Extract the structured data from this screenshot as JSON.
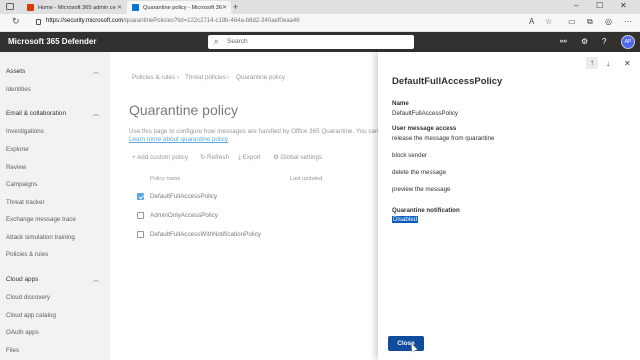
{
  "browser": {
    "tabs": [
      {
        "title": "Home - Microsoft 365 admin ce",
        "favicon_color": "#d83b01"
      },
      {
        "title": "Quarantine policy - Microsoft 36",
        "favicon_color": "#0078d4"
      }
    ],
    "url_host": "https://security.microsoft.com",
    "url_path": "/quarantinePolicies?tid=122c2714-c19b-464a-b8d2-340aef0eaa46",
    "icons": [
      "read-aloud-icon",
      "favorite-icon",
      "collections-icon",
      "browser-essentials-icon",
      "profile-icon",
      "more-icon"
    ]
  },
  "app": {
    "title": "Microsoft 365 Defender",
    "search_placeholder": "Search",
    "avatar_initials": "AP",
    "avatar_color": "#4f6bed"
  },
  "nav": {
    "sections": [
      {
        "label": "Assets",
        "items": [
          "Identities"
        ]
      },
      {
        "label": "Email & collaboration",
        "items": [
          "Investigations",
          "Explorer",
          "Review",
          "Campaigns",
          "Threat tracker",
          "Exchange message trace",
          "Attack simulation training",
          "Policies & rules"
        ]
      },
      {
        "label": "Cloud apps",
        "items": [
          "Cloud discovery",
          "Cloud app catalog",
          "OAuth apps",
          "Files"
        ]
      }
    ]
  },
  "main": {
    "breadcrumb": [
      "Policies & rules",
      "Threat policies",
      "Quarantine policy"
    ],
    "page_title": "Quarantine policy",
    "description": "Use this page to configure how messages are handled by Office 365 Quarantine. You can als",
    "learn_more": "Learn more about quarantine policy",
    "toolbar": {
      "add": "Add custom policy",
      "refresh": "Refresh",
      "export": "Export",
      "global": "Global settings"
    },
    "columns": {
      "name": "Policy name",
      "updated": "Last updated"
    },
    "rows": [
      {
        "name": "DefaultFullAccessPolicy",
        "checked": true
      },
      {
        "name": "AdminOnlyAccessPolicy",
        "checked": false
      },
      {
        "name": "DefaultFullAccessWithNotificationPolicy",
        "checked": false
      }
    ]
  },
  "panel": {
    "title": "DefaultFullAccessPolicy",
    "name_label": "Name",
    "name_value": "DefaultFullAccessPolicy",
    "uma_label": "User message access",
    "uma_values": [
      "release the message from quarantine",
      "block sender",
      "delete the message",
      "preview the message"
    ],
    "notification_label": "Quarantine notification",
    "notification_value": "Disabled",
    "close_button": "Close"
  }
}
